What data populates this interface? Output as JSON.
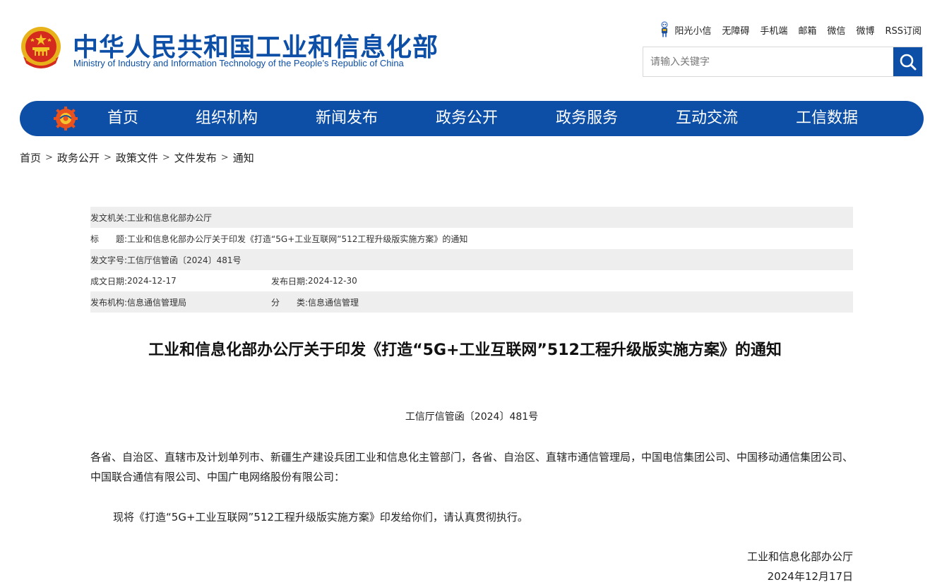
{
  "header": {
    "title": "中华人民共和国工业和信息化部",
    "subtitle": "Ministry of Industry and Information Technology of the People’s Republic of China",
    "top_links": [
      "阳光小信",
      "无障碍",
      "手机端",
      "邮箱",
      "微信",
      "微博",
      "RSS订阅"
    ],
    "search_placeholder": "请输入关键字"
  },
  "nav": {
    "items": [
      "首页",
      "组织机构",
      "新闻发布",
      "政务公开",
      "政务服务",
      "互动交流",
      "工信数据"
    ]
  },
  "breadcrumb": {
    "items": [
      "首页",
      "政务公开",
      "政策文件",
      "文件发布",
      "通知"
    ],
    "separator": ">"
  },
  "meta": {
    "issuer_label": "发文机关:",
    "issuer": "工业和信息化部办公厅",
    "title_label": "标　　题:",
    "title": "工业和信息化部办公厅关于印发《打造“5G+工业互联网”512工程升级版实施方案》的通知",
    "docno_label": "发文字号:",
    "docno": "工信厅信管函〔2024〕481号",
    "written_label": "成文日期:",
    "written": "2024-12-17",
    "published_label": "发布日期:",
    "published": "2024-12-30",
    "org_label": "发布机构:",
    "org": "信息通信管理局",
    "category_label": "分　　类:",
    "category": "信息通信管理"
  },
  "article": {
    "title": "工业和信息化部办公厅关于印发《打造“5G+工业互联网”512工程升级版实施方案》的通知",
    "doc_number": "工信厅信管函〔2024〕481号",
    "addressees": "各省、自治区、直辖市及计划单列市、新疆生产建设兵团工业和信息化主管部门，各省、自治区、直辖市通信管理局，中国电信集团公司、中国移动通信集团公司、中国联合通信有限公司、中国广电网络股份有限公司：",
    "body": "现将《打造“5G+工业互联网”512工程升级版实施方案》印发给你们，请认真贯彻执行。",
    "signature": "工业和信息化部办公厅",
    "date": "2024年12月17日"
  },
  "colors": {
    "brand_blue": "#0d4fa6",
    "meta_shade": "#eeeeee"
  }
}
